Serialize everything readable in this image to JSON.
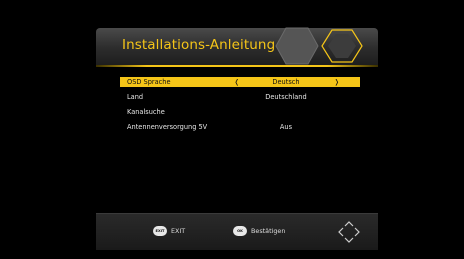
{
  "title": "Installations-Anleitung",
  "menu": {
    "rows": [
      {
        "label": "OSD Sprache",
        "value": "Deutsch",
        "arrow_left": "❬",
        "arrow_right": "❭"
      },
      {
        "label": "Land",
        "value": "Deutschland"
      },
      {
        "label": "Kanalsuche",
        "value": ""
      },
      {
        "label": "Antennenversorgung 5V",
        "value": "Aus"
      }
    ]
  },
  "footer": {
    "exit": {
      "icon_text": "EXIT",
      "label": "EXIT"
    },
    "ok": {
      "icon_text": "OK",
      "label": "Bestätigen"
    },
    "nav_icon": "navigation-arrows-icon"
  },
  "colors": {
    "accent": "#f5c518",
    "background": "#000000",
    "panel": "#2c2c2c"
  }
}
